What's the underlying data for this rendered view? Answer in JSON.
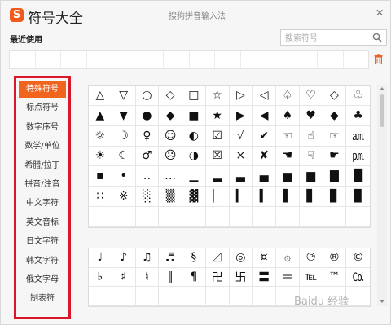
{
  "window": {
    "title": "符号大全",
    "subtitle": "搜狗拼音输入法",
    "logo_letter": "S",
    "close_glyph": "×"
  },
  "recent": {
    "label": "最近使用",
    "slots": 14
  },
  "search": {
    "placeholder": "搜索符号"
  },
  "colors": {
    "accent": "#f0641e",
    "highlight_box": "#d8182a",
    "logo": "#f05a1a"
  },
  "categories": [
    {
      "label": "特殊符号",
      "active": true
    },
    {
      "label": "标点符号",
      "active": false
    },
    {
      "label": "数字序号",
      "active": false
    },
    {
      "label": "数学/单位",
      "active": false
    },
    {
      "label": "希腊/拉丁",
      "active": false
    },
    {
      "label": "拼音/注音",
      "active": false
    },
    {
      "label": "中文字符",
      "active": false
    },
    {
      "label": "英文音标",
      "active": false
    },
    {
      "label": "日文字符",
      "active": false
    },
    {
      "label": "韩文字符",
      "active": false
    },
    {
      "label": "俄文字母",
      "active": false
    },
    {
      "label": "制表符",
      "active": false
    }
  ],
  "symbols_grid_1": [
    [
      "△",
      "▽",
      "○",
      "◇",
      "□",
      "☆",
      "▷",
      "◁",
      "♤",
      "♡",
      "◇",
      "♧"
    ],
    [
      "▲",
      "▼",
      "●",
      "◆",
      "■",
      "★",
      "▶",
      "◀",
      "♠",
      "♥",
      "◆",
      "♣"
    ],
    [
      "☼",
      "☽",
      "♀",
      "☺",
      "◐",
      "☑",
      "√",
      "✔",
      "☜",
      "☝",
      "☞",
      "㏂"
    ],
    [
      "☀",
      "☾",
      "♂",
      "☹",
      "◑",
      "☒",
      "×",
      "✘",
      "☚",
      "☟",
      "☛",
      "㏘"
    ],
    [
      "▪",
      "•",
      "‥",
      "…",
      "▁",
      "▂",
      "▃",
      "▄",
      "▅",
      "▆",
      "▇",
      "█"
    ],
    [
      "∷",
      "※",
      "░",
      "▒",
      "▓",
      "▏",
      "▎",
      "▍",
      "▌",
      "▋",
      "▊",
      "▉"
    ],
    [
      "",
      "",
      "",
      "",
      "",
      "",
      "",
      "",
      "",
      "",
      "",
      ""
    ]
  ],
  "symbols_grid_2": [
    [
      "♩",
      "♪",
      "♫",
      "♬",
      "§",
      "〼",
      "◎",
      "¤",
      "۞",
      "℗",
      "®",
      "©"
    ],
    [
      "♭",
      "♯",
      "♮",
      "‖",
      "¶",
      "卍",
      "卐",
      "〓",
      "＝",
      "℡",
      "™",
      "㏇"
    ],
    [
      "",
      "",
      "",
      "",
      "",
      "",
      "",
      "",
      "",
      "",
      "",
      ""
    ]
  ],
  "watermark": "Baidu 经验"
}
